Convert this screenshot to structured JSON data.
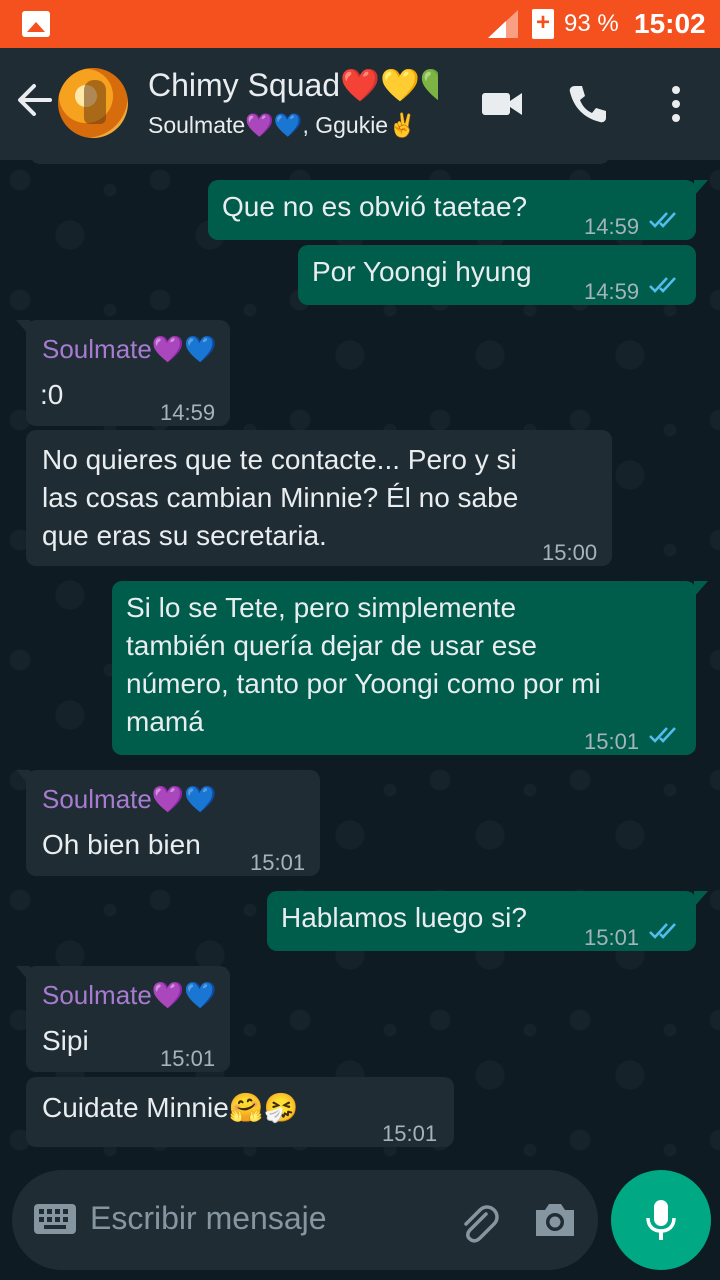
{
  "statusbar": {
    "battery": "93 %",
    "time": "15:02"
  },
  "header": {
    "title": "Chimy Squad❤️💛💚",
    "subtitle": "Soulmate💜💙, Ggukie✌️"
  },
  "messages": [
    {
      "dir": "out",
      "text": "Que no es obvió taetae?",
      "time": "14:59",
      "read": true
    },
    {
      "dir": "out",
      "text": "Por Yoongi hyung",
      "time": "14:59",
      "read": true
    },
    {
      "dir": "in",
      "sender": "Soulmate💜💙",
      "text": ":0",
      "time": "14:59"
    },
    {
      "dir": "in",
      "text": "No quieres que te contacte... Pero y si\nlas cosas cambian Minnie? Él no sabe\nque eras su secretaria.",
      "time": "15:00"
    },
    {
      "dir": "out",
      "text": "Si lo se Tete, pero simplemente\ntambién quería dejar de usar ese\nnúmero, tanto por Yoongi como por mi\nmamá",
      "time": "15:01",
      "read": true
    },
    {
      "dir": "in",
      "sender": "Soulmate💜💙",
      "text": "Oh bien bien",
      "time": "15:01"
    },
    {
      "dir": "out",
      "text": "Hablamos luego si?",
      "time": "15:01",
      "read": true
    },
    {
      "dir": "in",
      "sender": "Soulmate💜💙",
      "text": "Sipi",
      "time": "15:01"
    },
    {
      "dir": "in",
      "text": "Cuidate Minnie🤗🤧",
      "time": "15:01"
    }
  ],
  "composer": {
    "placeholder": "Escribir mensaje"
  },
  "colors": {
    "outgoing": "#005c4b",
    "incoming": "#1f2c34",
    "accent": "#00a884",
    "statusbar": "#f4511e",
    "read_ticks": "#53bdeb"
  }
}
